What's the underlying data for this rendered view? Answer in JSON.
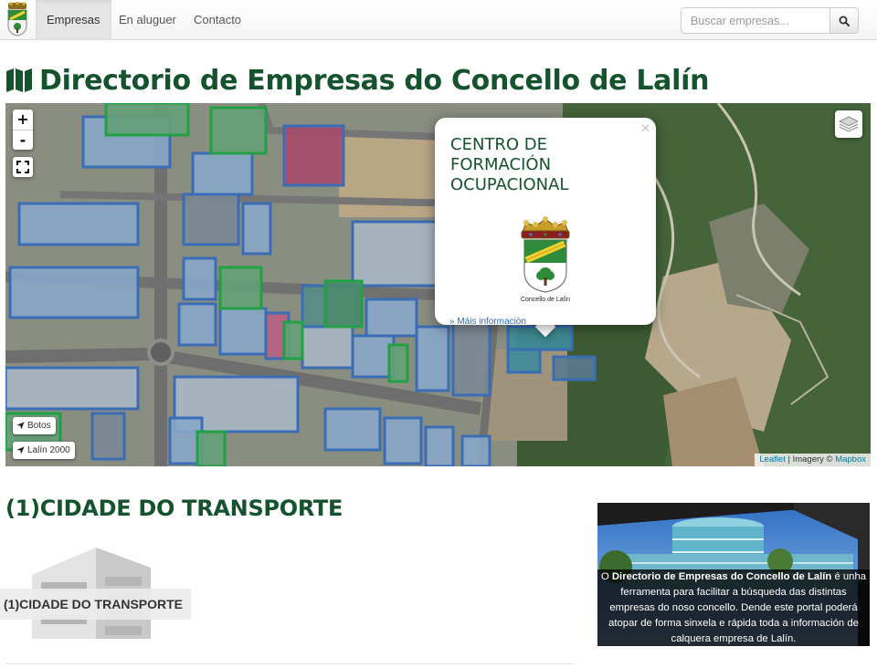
{
  "nav": {
    "items": [
      {
        "label": "Empresas",
        "active": true
      },
      {
        "label": "En aluguer",
        "active": false
      },
      {
        "label": "Contacto",
        "active": false
      }
    ],
    "search_placeholder": "Buscar empresas..."
  },
  "page_title": "Directorio de Empresas do Concello de Lalín",
  "map": {
    "zoom_in": "+",
    "zoom_out": "-",
    "locate_buttons": [
      "Botos",
      "Lalín 2000"
    ],
    "attribution": {
      "leaflet": "Leaflet",
      "sep": " | Imagery © ",
      "mapbox": "Mapbox"
    },
    "popup": {
      "close": "×",
      "title": "CENTRO DE FORMACIÓN OCUPACIONAL",
      "crest_caption": "Concello de Lalín",
      "link": "» Máis información"
    }
  },
  "section": {
    "title": "(1)CIDADE DO TRANSPORTE",
    "card_label": "(1)CIDADE DO TRANSPORTE"
  },
  "promo": {
    "lead": "O ",
    "bold": "Directorio de Empresas do Concello de Lalín",
    "rest": " é unha ferramenta para facilitar a búsqueda das distintas empresas do noso concello. Dende este portal poderá atopar de forma sinxela e rápida toda a información de calquera empresa de Lalín."
  },
  "colors": {
    "brand_green": "#14532d",
    "building_blue": "#3a6db5",
    "building_green": "#22a045",
    "link": "#2a6ebb"
  }
}
